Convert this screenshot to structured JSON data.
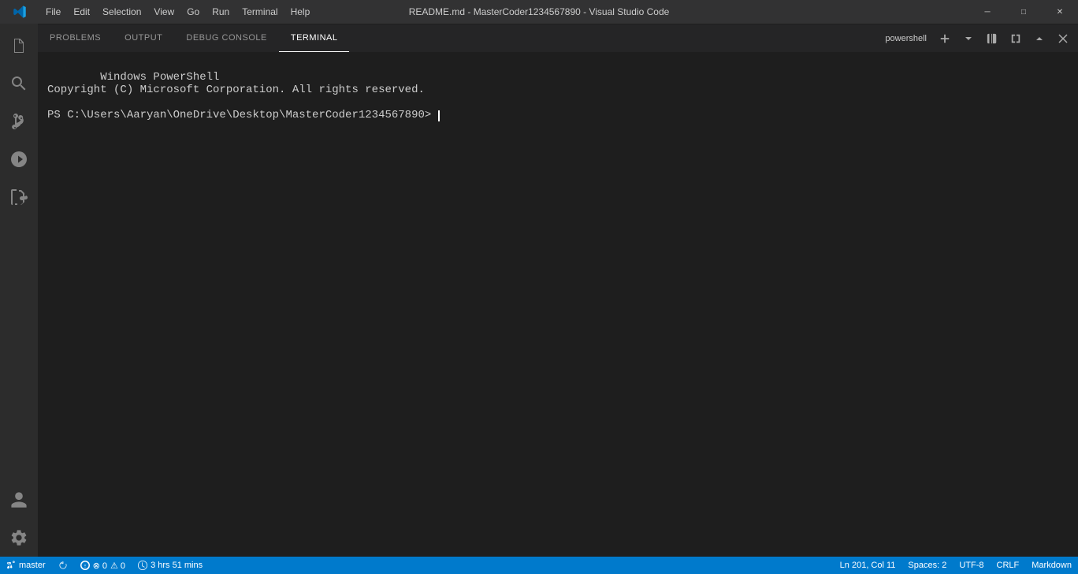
{
  "titleBar": {
    "title": "README.md - MasterCoder1234567890 - Visual Studio Code"
  },
  "menuBar": {
    "items": [
      "File",
      "Edit",
      "Selection",
      "View",
      "Go",
      "Run",
      "Terminal",
      "Help"
    ]
  },
  "windowControls": {
    "minimize": "─",
    "maximize": "□",
    "close": "✕"
  },
  "activityBar": {
    "icons": [
      {
        "name": "explorer-icon",
        "label": "Explorer"
      },
      {
        "name": "search-icon",
        "label": "Search"
      },
      {
        "name": "source-control-icon",
        "label": "Source Control"
      },
      {
        "name": "run-debug-icon",
        "label": "Run and Debug"
      },
      {
        "name": "extensions-icon",
        "label": "Extensions"
      }
    ],
    "bottomIcons": [
      {
        "name": "account-icon",
        "label": "Account"
      },
      {
        "name": "settings-icon",
        "label": "Manage"
      }
    ]
  },
  "panel": {
    "tabs": [
      "PROBLEMS",
      "OUTPUT",
      "DEBUG CONSOLE",
      "TERMINAL"
    ],
    "activeTab": "TERMINAL",
    "terminalLabel": "powershell",
    "terminalContent": {
      "line1": "Windows PowerShell",
      "line2": "Copyright (C) Microsoft Corporation. All rights reserved.",
      "line3": "",
      "prompt": "PS C:\\Users\\Aaryan\\OneDrive\\Desktop\\MasterCoder1234567890> "
    }
  },
  "statusBar": {
    "branch": "master",
    "sync": "",
    "errors": "0",
    "warnings": "0",
    "time": "3 hrs 51 mins",
    "position": "Ln 201, Col 11",
    "spaces": "Spaces: 2",
    "encoding": "UTF-8",
    "lineEnding": "CRLF",
    "language": "Markdown"
  }
}
